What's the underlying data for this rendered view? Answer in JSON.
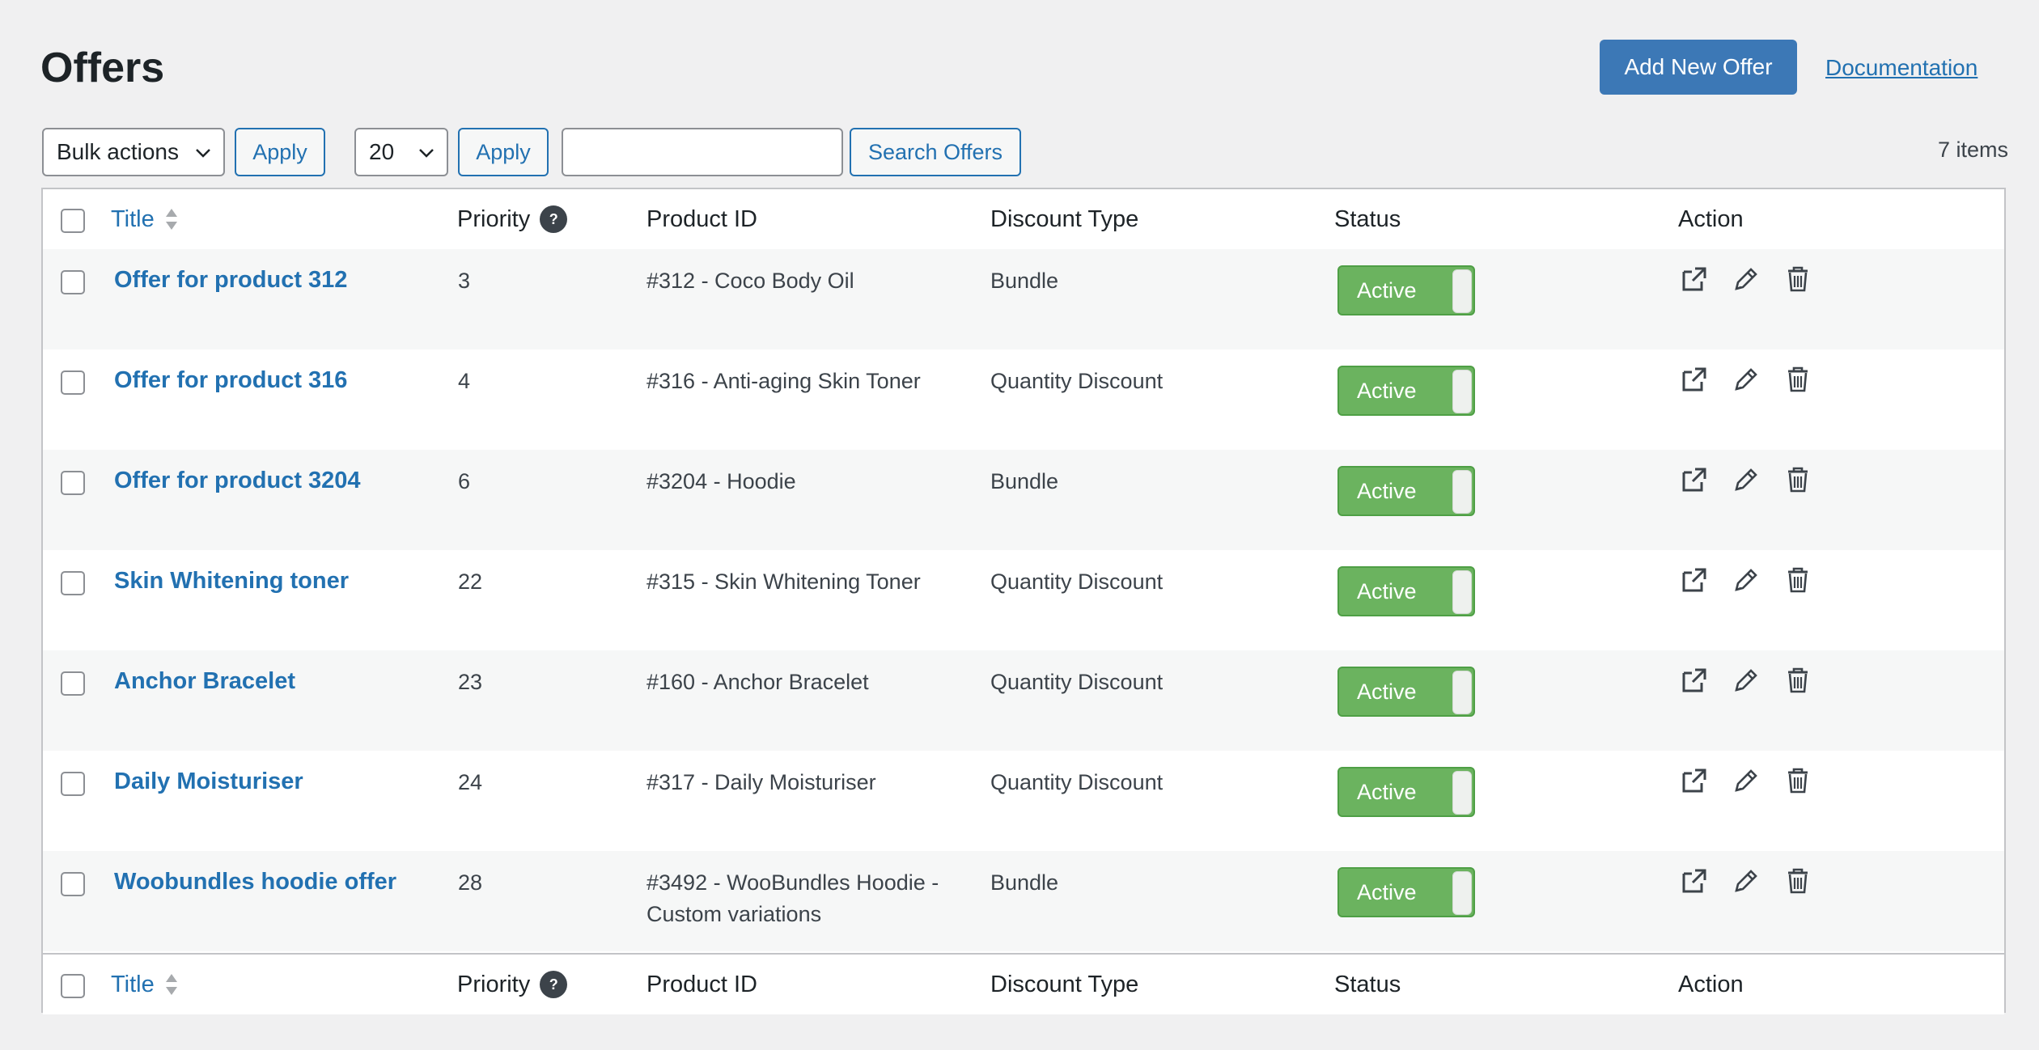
{
  "header": {
    "title": "Offers",
    "add_button": "Add New Offer",
    "doc_link": "Documentation"
  },
  "toolbar": {
    "bulk_actions": "Bulk actions",
    "apply": "Apply",
    "per_page": "20",
    "apply2": "Apply",
    "search_value": "",
    "search_button": "Search Offers",
    "items_count": "7 items"
  },
  "columns": {
    "title": "Title",
    "priority": "Priority",
    "help": "?",
    "product_id": "Product ID",
    "discount_type": "Discount Type",
    "status": "Status",
    "action": "Action"
  },
  "rows": [
    {
      "title": "Offer for product 312",
      "priority": "3",
      "product": "#312 - Coco Body Oil",
      "discount": "Bundle",
      "status": "Active"
    },
    {
      "title": "Offer for product 316",
      "priority": "4",
      "product": "#316 - Anti-aging Skin Toner",
      "discount": "Quantity Discount",
      "status": "Active"
    },
    {
      "title": "Offer for product 3204",
      "priority": "6",
      "product": "#3204 - Hoodie",
      "discount": "Bundle",
      "status": "Active"
    },
    {
      "title": "Skin Whitening toner",
      "priority": "22",
      "product": "#315 - Skin Whitening Toner",
      "discount": "Quantity Discount",
      "status": "Active"
    },
    {
      "title": "Anchor Bracelet",
      "priority": "23",
      "product": "#160 - Anchor Bracelet",
      "discount": "Quantity Discount",
      "status": "Active"
    },
    {
      "title": "Daily Moisturiser",
      "priority": "24",
      "product": "#317 - Daily Moisturiser",
      "discount": "Quantity Discount",
      "status": "Active"
    },
    {
      "title": "Woobundles hoodie offer",
      "priority": "28",
      "product": "#3492 - WooBundles Hoodie - Custom variations",
      "discount": "Bundle",
      "status": "Active"
    }
  ],
  "icons": {
    "view": "external-link-icon",
    "edit": "pencil-icon",
    "delete": "trash-icon",
    "sort": "sort-arrows-icon",
    "dropdown": "chevron-down-icon"
  },
  "colors": {
    "primary": "#3c78b6",
    "link": "#2271b1",
    "active_toggle": "#6bb35f"
  }
}
